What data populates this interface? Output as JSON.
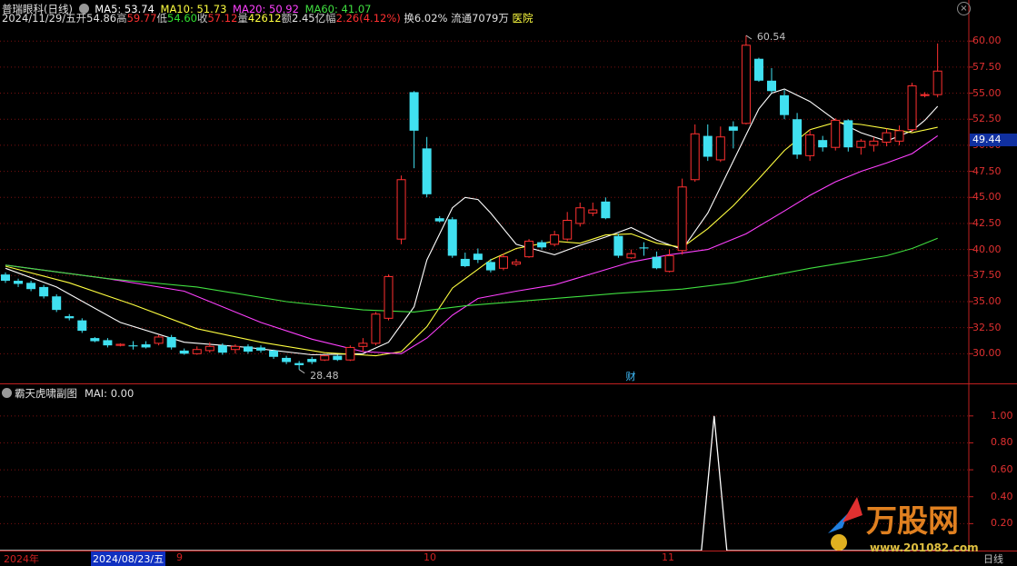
{
  "header": {
    "title": "普瑞眼科(日线)",
    "date": "2024/11/29/五",
    "open_label": "开",
    "open": "54.86",
    "high_label": "高",
    "high": "59.77",
    "low_label": "低",
    "low": "54.60",
    "close_label": "收",
    "close": "57.12",
    "vol_label": "量",
    "vol": "42612",
    "amt_label": "额",
    "amt": "2.45亿",
    "chg_label": "幅",
    "chg": "2.26(4.12%)",
    "turnover": "换6.02%",
    "float": "流通7079万",
    "sector": "医院",
    "ma5": "MA5: 53.74",
    "ma10": "MA10: 51.73",
    "ma20": "MA20: 50.92",
    "ma60": "MA60: 41.07"
  },
  "sub_header": {
    "name": "霸天虎啸副图",
    "mai": "MAI: 0.00"
  },
  "annotations": {
    "high_mark": "60.54",
    "low_mark": "28.48",
    "cai": "财"
  },
  "price_axis": [
    "60.00",
    "57.50",
    "55.00",
    "52.50",
    "50.00",
    "47.50",
    "45.00",
    "42.50",
    "40.00",
    "37.50",
    "35.00",
    "32.50",
    "30.00"
  ],
  "current_price": "49.44",
  "sub_axis": [
    "1.00",
    "0.80",
    "0.60",
    "0.40",
    "0.20"
  ],
  "date_axis": {
    "year": "2024年",
    "selected": "2024/08/23/五",
    "m9": "9",
    "m10": "10",
    "m11": "11",
    "period": "日线"
  },
  "watermark": {
    "brand": "万股网",
    "url": "www.201082.com"
  },
  "colors": {
    "up": "#ff3030",
    "down": "#40e0f0",
    "ma5": "#ffffff",
    "ma10": "#ffff40",
    "ma20": "#ff40ff",
    "ma60": "#40e040"
  },
  "chart_data": {
    "type": "candlestick",
    "ylim": [
      27.5,
      61.5
    ],
    "candles": [
      [
        37.6,
        37.0,
        37.8,
        36.8
      ],
      [
        37.0,
        36.7,
        37.2,
        36.4
      ],
      [
        36.8,
        36.2,
        37.0,
        36.0
      ],
      [
        36.4,
        35.5,
        36.6,
        35.3
      ],
      [
        35.5,
        34.2,
        35.7,
        34.0
      ],
      [
        33.6,
        33.4,
        33.8,
        33.2
      ],
      [
        33.2,
        32.2,
        33.4,
        32.0
      ],
      [
        31.5,
        31.2,
        31.6,
        31.1
      ],
      [
        31.3,
        30.8,
        31.5,
        30.6
      ],
      [
        30.8,
        30.9,
        31.0,
        30.7
      ],
      [
        30.8,
        30.7,
        31.2,
        30.4
      ],
      [
        30.9,
        30.6,
        31.2,
        30.5
      ],
      [
        31.0,
        31.6,
        31.8,
        30.8
      ],
      [
        31.6,
        30.6,
        31.8,
        30.4
      ],
      [
        30.3,
        30.0,
        30.5,
        29.9
      ],
      [
        30.0,
        30.4,
        30.7,
        29.9
      ],
      [
        30.3,
        30.7,
        31.1,
        30.1
      ],
      [
        30.8,
        30.1,
        31.0,
        29.9
      ],
      [
        30.4,
        30.7,
        30.9,
        30.0
      ],
      [
        30.7,
        30.2,
        30.9,
        30.0
      ],
      [
        30.6,
        30.3,
        30.8,
        30.1
      ],
      [
        30.3,
        29.7,
        30.4,
        29.5
      ],
      [
        29.6,
        29.2,
        29.8,
        29.0
      ],
      [
        29.1,
        28.9,
        29.3,
        28.48
      ],
      [
        29.5,
        29.2,
        29.7,
        29.0
      ],
      [
        29.4,
        29.8,
        29.9,
        29.3
      ],
      [
        29.8,
        29.4,
        29.9,
        29.3
      ],
      [
        29.4,
        30.6,
        30.8,
        29.3
      ],
      [
        30.7,
        31.0,
        31.5,
        30.2
      ],
      [
        31.0,
        33.8,
        34.0,
        30.8
      ],
      [
        33.4,
        37.4,
        37.6,
        33.2
      ],
      [
        41.0,
        46.7,
        47.1,
        40.5
      ],
      [
        55.1,
        51.4,
        55.2,
        47.8
      ],
      [
        49.7,
        45.3,
        50.8,
        45.0
      ],
      [
        43.0,
        42.7,
        43.2,
        42.6
      ],
      [
        42.9,
        39.4,
        43.1,
        39.2
      ],
      [
        39.1,
        38.4,
        39.7,
        38.3
      ],
      [
        39.6,
        39.0,
        40.1,
        38.7
      ],
      [
        38.8,
        38.0,
        39.1,
        37.8
      ],
      [
        38.2,
        39.3,
        39.6,
        38.0
      ],
      [
        38.6,
        38.8,
        39.1,
        38.4
      ],
      [
        39.3,
        40.8,
        41.0,
        39.2
      ],
      [
        40.7,
        40.2,
        40.9,
        40.0
      ],
      [
        40.5,
        41.4,
        41.8,
        40.3
      ],
      [
        41.0,
        42.8,
        43.6,
        40.8
      ],
      [
        42.5,
        44.0,
        44.5,
        42.2
      ],
      [
        43.5,
        43.8,
        44.5,
        43.2
      ],
      [
        44.6,
        43.0,
        45.0,
        42.9
      ],
      [
        41.3,
        39.4,
        41.5,
        39.2
      ],
      [
        39.2,
        39.6,
        40.0,
        39.1
      ],
      [
        40.2,
        40.1,
        40.7,
        39.4
      ],
      [
        39.3,
        38.2,
        39.8,
        38.1
      ],
      [
        37.9,
        39.4,
        40.0,
        37.8
      ],
      [
        39.9,
        46.0,
        46.8,
        39.5
      ],
      [
        46.7,
        51.1,
        52.0,
        46.5
      ],
      [
        50.9,
        48.9,
        52.0,
        48.5
      ],
      [
        48.6,
        50.8,
        51.8,
        48.4
      ],
      [
        51.8,
        51.4,
        52.3,
        49.7
      ],
      [
        52.1,
        59.6,
        60.54,
        52.0
      ],
      [
        58.3,
        56.2,
        58.4,
        56.1
      ],
      [
        56.2,
        55.2,
        57.4,
        55.0
      ],
      [
        54.8,
        52.9,
        55.3,
        52.5
      ],
      [
        52.5,
        49.1,
        53.1,
        48.7
      ],
      [
        49.0,
        51.0,
        51.5,
        48.5
      ],
      [
        50.5,
        49.8,
        50.9,
        49.4
      ],
      [
        49.8,
        52.4,
        52.6,
        49.5
      ],
      [
        52.4,
        49.8,
        52.5,
        49.4
      ],
      [
        49.8,
        50.4,
        50.6,
        49.1
      ],
      [
        50.0,
        50.4,
        50.8,
        49.4
      ],
      [
        50.3,
        51.2,
        51.6,
        49.9
      ],
      [
        50.4,
        51.4,
        51.9,
        50.0
      ],
      [
        51.5,
        55.7,
        56.0,
        51.3
      ],
      [
        54.86,
        54.86,
        55.1,
        54.6
      ],
      [
        54.86,
        57.12,
        59.77,
        54.6
      ]
    ],
    "ma": {
      "MA5": [
        [
          0,
          38.2
        ],
        [
          4,
          36.4
        ],
        [
          9,
          33.0
        ],
        [
          14,
          31.1
        ],
        [
          19,
          30.6
        ],
        [
          24,
          29.9
        ],
        [
          28,
          30.0
        ],
        [
          30,
          31.1
        ],
        [
          32,
          34.5
        ],
        [
          33,
          39.0
        ],
        [
          35,
          44.0
        ],
        [
          36,
          45.0
        ],
        [
          37,
          44.8
        ],
        [
          38,
          43.5
        ],
        [
          40,
          40.5
        ],
        [
          43,
          39.5
        ],
        [
          45,
          40.4
        ],
        [
          47,
          41.2
        ],
        [
          49,
          42.1
        ],
        [
          51,
          40.9
        ],
        [
          53,
          40.0
        ],
        [
          55,
          43.5
        ],
        [
          57,
          48.5
        ],
        [
          58,
          51.0
        ],
        [
          59,
          53.5
        ],
        [
          60,
          55.0
        ],
        [
          61,
          55.4
        ],
        [
          63,
          54.2
        ],
        [
          65,
          52.4
        ],
        [
          67,
          51.2
        ],
        [
          69,
          50.4
        ],
        [
          71,
          51.4
        ],
        [
          72,
          52.4
        ],
        [
          73,
          53.74
        ]
      ],
      "MA10": [
        [
          0,
          38.4
        ],
        [
          5,
          36.8
        ],
        [
          10,
          34.7
        ],
        [
          15,
          32.4
        ],
        [
          20,
          31.1
        ],
        [
          25,
          30.1
        ],
        [
          29,
          29.8
        ],
        [
          31,
          30.2
        ],
        [
          33,
          32.6
        ],
        [
          35,
          36.3
        ],
        [
          38,
          39.0
        ],
        [
          40,
          40.1
        ],
        [
          43,
          40.8
        ],
        [
          45,
          40.6
        ],
        [
          47,
          41.4
        ],
        [
          49,
          41.5
        ],
        [
          51,
          40.6
        ],
        [
          53,
          40.2
        ],
        [
          55,
          42.0
        ],
        [
          57,
          44.2
        ],
        [
          59,
          46.8
        ],
        [
          61,
          49.5
        ],
        [
          63,
          51.5
        ],
        [
          65,
          52.2
        ],
        [
          67,
          52.0
        ],
        [
          69,
          51.6
        ],
        [
          71,
          51.2
        ],
        [
          73,
          51.73
        ]
      ],
      "MA20": [
        [
          0,
          38.5
        ],
        [
          8,
          37.2
        ],
        [
          14,
          36.0
        ],
        [
          20,
          33.0
        ],
        [
          24,
          31.4
        ],
        [
          28,
          30.2
        ],
        [
          31,
          30.0
        ],
        [
          33,
          31.5
        ],
        [
          35,
          33.7
        ],
        [
          37,
          35.3
        ],
        [
          40,
          36.0
        ],
        [
          43,
          36.6
        ],
        [
          46,
          37.7
        ],
        [
          49,
          38.8
        ],
        [
          52,
          39.5
        ],
        [
          55,
          40.0
        ],
        [
          58,
          41.5
        ],
        [
          61,
          43.7
        ],
        [
          63,
          45.2
        ],
        [
          65,
          46.5
        ],
        [
          67,
          47.5
        ],
        [
          69,
          48.3
        ],
        [
          71,
          49.2
        ],
        [
          73,
          50.92
        ]
      ],
      "MA60": [
        [
          0,
          38.5
        ],
        [
          8,
          37.2
        ],
        [
          15,
          36.4
        ],
        [
          22,
          35.0
        ],
        [
          28,
          34.2
        ],
        [
          32,
          34.0
        ],
        [
          36,
          34.6
        ],
        [
          42,
          35.2
        ],
        [
          48,
          35.8
        ],
        [
          53,
          36.2
        ],
        [
          57,
          36.8
        ],
        [
          60,
          37.5
        ],
        [
          63,
          38.2
        ],
        [
          66,
          38.8
        ],
        [
          69,
          39.4
        ],
        [
          71,
          40.1
        ],
        [
          73,
          41.07
        ]
      ]
    },
    "sub_series": {
      "name": "MAI",
      "spike_index": 55.5,
      "spike_value": 1.0,
      "ylim": [
        0,
        1.1
      ]
    }
  }
}
